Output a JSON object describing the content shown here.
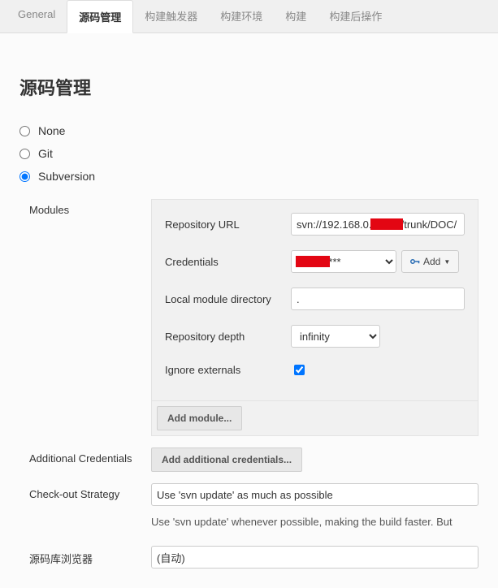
{
  "tabs": [
    {
      "label": "General"
    },
    {
      "label": "源码管理"
    },
    {
      "label": "构建触发器"
    },
    {
      "label": "构建环境"
    },
    {
      "label": "构建"
    },
    {
      "label": "构建后操作"
    }
  ],
  "section_title": "源码管理",
  "scm": {
    "none_label": "None",
    "git_label": "Git",
    "svn_label": "Subversion"
  },
  "svn": {
    "modules_label": "Modules",
    "repo_url_label": "Repository URL",
    "repo_url_value": "svn://192.168.0.          /trunk/DOC/",
    "credentials_label": "Credentials",
    "credentials_value": "kui/******",
    "add_button_label": "Add",
    "local_dir_label": "Local module directory",
    "local_dir_value": ".",
    "depth_label": "Repository depth",
    "depth_value": "infinity",
    "ignore_externals_label": "Ignore externals",
    "ignore_externals_checked": true,
    "add_module_label": "Add module...",
    "additional_credentials_label": "Additional Credentials",
    "add_additional_credentials_label": "Add additional credentials...",
    "checkout_strategy_label": "Check-out Strategy",
    "checkout_strategy_value": "Use 'svn update' as much as possible",
    "checkout_strategy_help": "Use 'svn update' whenever possible, making the build faster. But",
    "repo_browser_label": "源码库浏览器",
    "repo_browser_value": "(自动)"
  }
}
